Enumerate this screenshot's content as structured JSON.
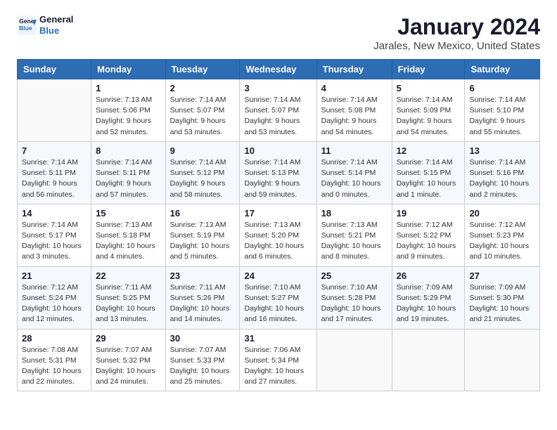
{
  "logo": {
    "line1": "General",
    "line2": "Blue"
  },
  "title": "January 2024",
  "subtitle": "Jarales, New Mexico, United States",
  "days_of_week": [
    "Sunday",
    "Monday",
    "Tuesday",
    "Wednesday",
    "Thursday",
    "Friday",
    "Saturday"
  ],
  "weeks": [
    [
      {
        "day": "",
        "info": ""
      },
      {
        "day": "1",
        "info": "Sunrise: 7:13 AM\nSunset: 5:06 PM\nDaylight: 9 hours\nand 52 minutes."
      },
      {
        "day": "2",
        "info": "Sunrise: 7:14 AM\nSunset: 5:07 PM\nDaylight: 9 hours\nand 53 minutes."
      },
      {
        "day": "3",
        "info": "Sunrise: 7:14 AM\nSunset: 5:07 PM\nDaylight: 9 hours\nand 53 minutes."
      },
      {
        "day": "4",
        "info": "Sunrise: 7:14 AM\nSunset: 5:08 PM\nDaylight: 9 hours\nand 54 minutes."
      },
      {
        "day": "5",
        "info": "Sunrise: 7:14 AM\nSunset: 5:09 PM\nDaylight: 9 hours\nand 54 minutes."
      },
      {
        "day": "6",
        "info": "Sunrise: 7:14 AM\nSunset: 5:10 PM\nDaylight: 9 hours\nand 55 minutes."
      }
    ],
    [
      {
        "day": "7",
        "info": "Sunrise: 7:14 AM\nSunset: 5:11 PM\nDaylight: 9 hours\nand 56 minutes."
      },
      {
        "day": "8",
        "info": "Sunrise: 7:14 AM\nSunset: 5:11 PM\nDaylight: 9 hours\nand 57 minutes."
      },
      {
        "day": "9",
        "info": "Sunrise: 7:14 AM\nSunset: 5:12 PM\nDaylight: 9 hours\nand 58 minutes."
      },
      {
        "day": "10",
        "info": "Sunrise: 7:14 AM\nSunset: 5:13 PM\nDaylight: 9 hours\nand 59 minutes."
      },
      {
        "day": "11",
        "info": "Sunrise: 7:14 AM\nSunset: 5:14 PM\nDaylight: 10 hours\nand 0 minutes."
      },
      {
        "day": "12",
        "info": "Sunrise: 7:14 AM\nSunset: 5:15 PM\nDaylight: 10 hours\nand 1 minute."
      },
      {
        "day": "13",
        "info": "Sunrise: 7:14 AM\nSunset: 5:16 PM\nDaylight: 10 hours\nand 2 minutes."
      }
    ],
    [
      {
        "day": "14",
        "info": "Sunrise: 7:14 AM\nSunset: 5:17 PM\nDaylight: 10 hours\nand 3 minutes."
      },
      {
        "day": "15",
        "info": "Sunrise: 7:13 AM\nSunset: 5:18 PM\nDaylight: 10 hours\nand 4 minutes."
      },
      {
        "day": "16",
        "info": "Sunrise: 7:13 AM\nSunset: 5:19 PM\nDaylight: 10 hours\nand 5 minutes."
      },
      {
        "day": "17",
        "info": "Sunrise: 7:13 AM\nSunset: 5:20 PM\nDaylight: 10 hours\nand 6 minutes."
      },
      {
        "day": "18",
        "info": "Sunrise: 7:13 AM\nSunset: 5:21 PM\nDaylight: 10 hours\nand 8 minutes."
      },
      {
        "day": "19",
        "info": "Sunrise: 7:12 AM\nSunset: 5:22 PM\nDaylight: 10 hours\nand 9 minutes."
      },
      {
        "day": "20",
        "info": "Sunrise: 7:12 AM\nSunset: 5:23 PM\nDaylight: 10 hours\nand 10 minutes."
      }
    ],
    [
      {
        "day": "21",
        "info": "Sunrise: 7:12 AM\nSunset: 5:24 PM\nDaylight: 10 hours\nand 12 minutes."
      },
      {
        "day": "22",
        "info": "Sunrise: 7:11 AM\nSunset: 5:25 PM\nDaylight: 10 hours\nand 13 minutes."
      },
      {
        "day": "23",
        "info": "Sunrise: 7:11 AM\nSunset: 5:26 PM\nDaylight: 10 hours\nand 14 minutes."
      },
      {
        "day": "24",
        "info": "Sunrise: 7:10 AM\nSunset: 5:27 PM\nDaylight: 10 hours\nand 16 minutes."
      },
      {
        "day": "25",
        "info": "Sunrise: 7:10 AM\nSunset: 5:28 PM\nDaylight: 10 hours\nand 17 minutes."
      },
      {
        "day": "26",
        "info": "Sunrise: 7:09 AM\nSunset: 5:29 PM\nDaylight: 10 hours\nand 19 minutes."
      },
      {
        "day": "27",
        "info": "Sunrise: 7:09 AM\nSunset: 5:30 PM\nDaylight: 10 hours\nand 21 minutes."
      }
    ],
    [
      {
        "day": "28",
        "info": "Sunrise: 7:08 AM\nSunset: 5:31 PM\nDaylight: 10 hours\nand 22 minutes."
      },
      {
        "day": "29",
        "info": "Sunrise: 7:07 AM\nSunset: 5:32 PM\nDaylight: 10 hours\nand 24 minutes."
      },
      {
        "day": "30",
        "info": "Sunrise: 7:07 AM\nSunset: 5:33 PM\nDaylight: 10 hours\nand 25 minutes."
      },
      {
        "day": "31",
        "info": "Sunrise: 7:06 AM\nSunset: 5:34 PM\nDaylight: 10 hours\nand 27 minutes."
      },
      {
        "day": "",
        "info": ""
      },
      {
        "day": "",
        "info": ""
      },
      {
        "day": "",
        "info": ""
      }
    ]
  ]
}
